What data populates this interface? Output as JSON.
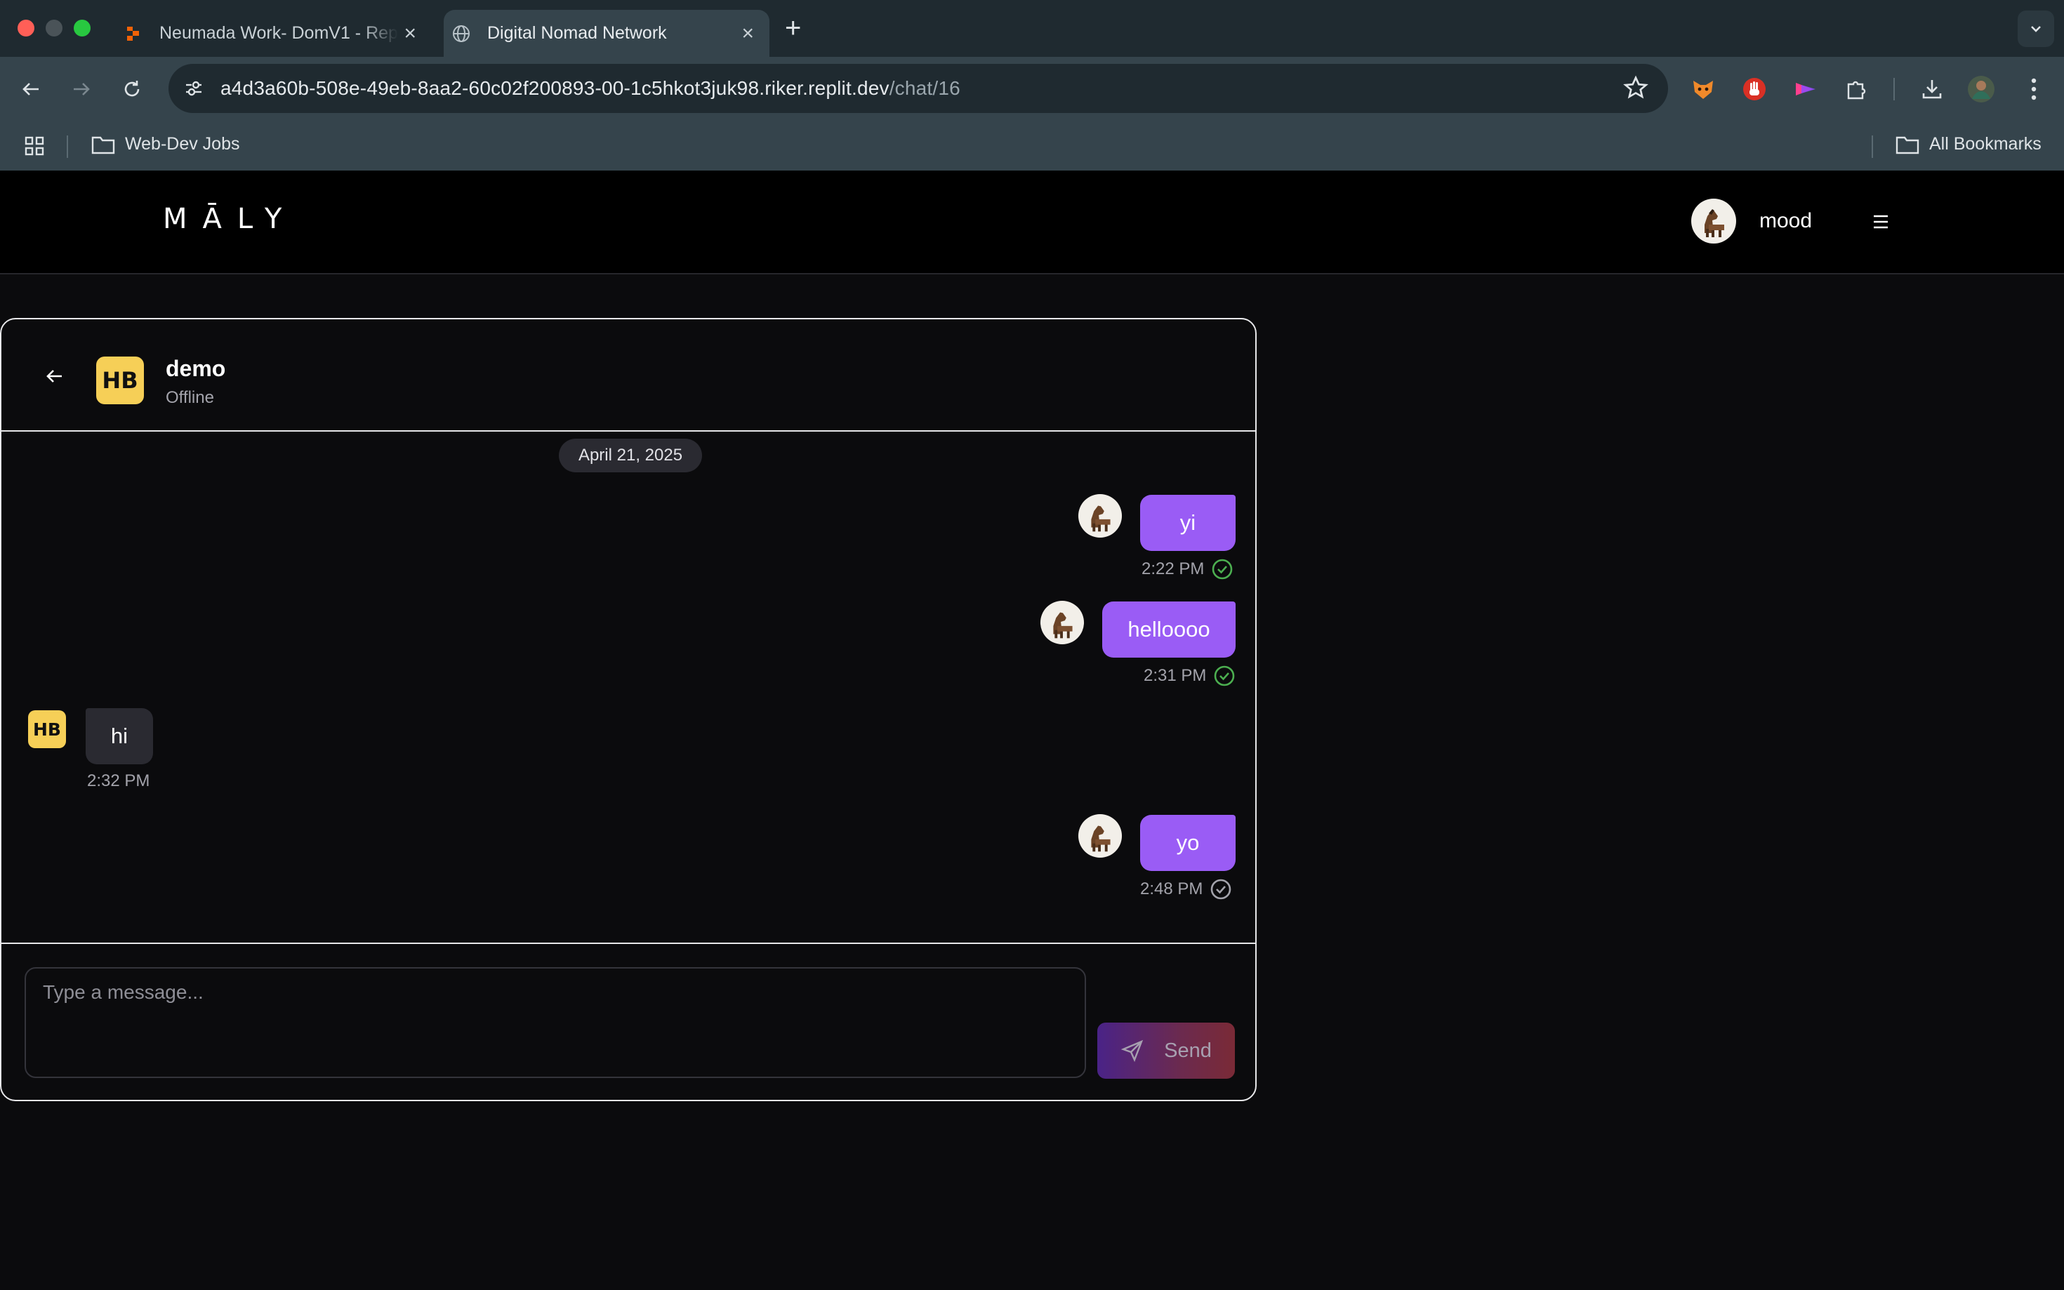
{
  "browser": {
    "tabs": [
      {
        "title": "Neumada Work- DomV1 - Replit",
        "active": false
      },
      {
        "title": "Digital Nomad Network",
        "active": true
      }
    ],
    "url": {
      "host": "a4d3a60b-508e-49eb-8aa2-60c02f200893-00-1c5hkot3juk98.riker.replit.dev",
      "path": "/chat/16"
    },
    "bookmarks": [
      {
        "label": "Web-Dev Jobs",
        "icon": "folder-icon"
      }
    ],
    "all_bookmarks_label": "All Bookmarks"
  },
  "app": {
    "logo": "MĀLY",
    "user": {
      "name": "mood",
      "avatar_icon": "horse-avatar-icon"
    }
  },
  "chat": {
    "contact": {
      "name": "demo",
      "status": "Offline",
      "avatar_text": "HB",
      "avatar_color": "#f6cf57"
    },
    "date_divider": "April 21, 2025",
    "messages": [
      {
        "direction": "out",
        "text": "yi",
        "time": "2:22 PM",
        "read": true
      },
      {
        "direction": "out",
        "text": "helloooo",
        "time": "2:31 PM",
        "read": true
      },
      {
        "direction": "in",
        "text": "hi",
        "time": "2:32 PM"
      },
      {
        "direction": "out",
        "text": "yo",
        "time": "2:48 PM",
        "read": false
      }
    ],
    "composer": {
      "placeholder": "Type a message...",
      "send_label": "Send"
    }
  },
  "colors": {
    "outgoing_bubble": "#9a5cf5",
    "incoming_bubble": "#2a2a31",
    "read_check": "#4caf50",
    "background": "#0b0b0d"
  }
}
